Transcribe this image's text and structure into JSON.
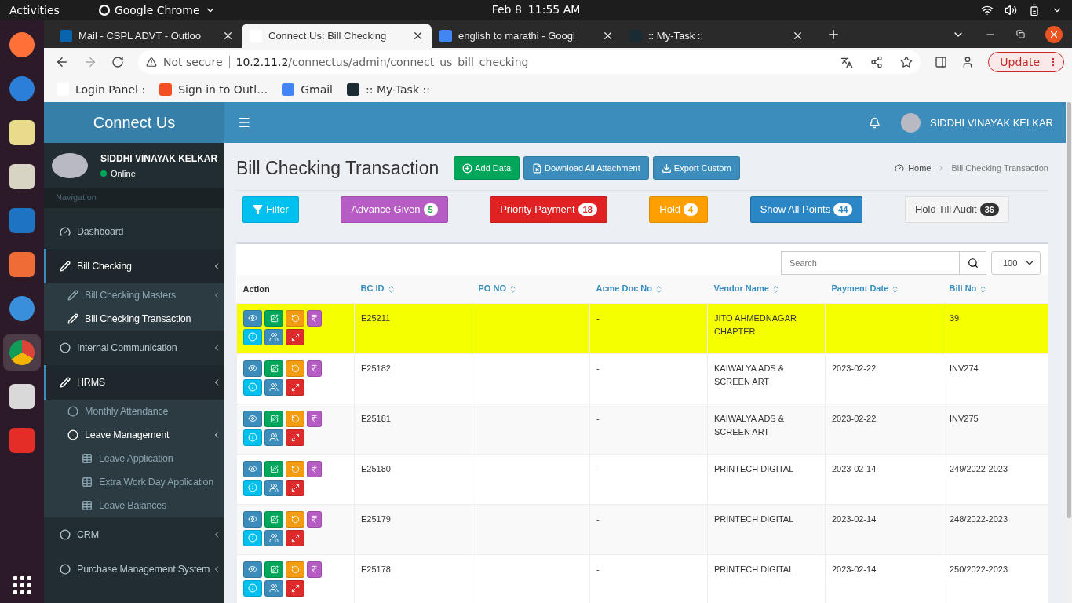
{
  "system_bar": {
    "activities": "Activities",
    "app_name": "Google Chrome",
    "date": "Feb 8",
    "time": "11:55 AM"
  },
  "browser": {
    "tabs": [
      {
        "title": "Mail - CSPL ADVT - Outloo",
        "selected": false,
        "kind": "outlook"
      },
      {
        "title": "Connect Us: Bill Checking",
        "selected": true,
        "kind": "site"
      },
      {
        "title": "english to marathi - Googl",
        "selected": false,
        "kind": "google"
      },
      {
        "title": ":: My-Task ::",
        "selected": false,
        "kind": "react"
      }
    ],
    "address": {
      "security": "Not secure",
      "host": "10.2.11.2",
      "path": "/connectus/admin/connect_us_bill_checking"
    },
    "update_button": "Update",
    "bookmarks": [
      {
        "label": "Login Panel :",
        "kind": "site"
      },
      {
        "label": "Sign in to Outl…",
        "kind": "windows"
      },
      {
        "label": "Gmail",
        "kind": "google"
      },
      {
        "label": ":: My-Task ::",
        "kind": "react"
      }
    ]
  },
  "app": {
    "brand": "Connect Us",
    "header_user": "SIDDHI VINAYAK KELKAR",
    "sidebar": {
      "user_name": "SIDDHI VINAYAK KELKAR",
      "status": "Online",
      "nav_header": "Navigation",
      "items": [
        {
          "label": "Dashboard",
          "kind": "gauge",
          "selected": false
        },
        {
          "label": "Bill Checking",
          "kind": "pencil",
          "selected": true,
          "has_submenu": true,
          "expanded": true,
          "children": [
            {
              "label": "Bill Checking Masters",
              "kind": "pencil",
              "selected": false,
              "has_submenu": true
            },
            {
              "label": "Bill Checking Transaction",
              "kind": "pencil",
              "selected": true
            }
          ]
        },
        {
          "label": "Internal Communication",
          "kind": "circle",
          "selected": false,
          "has_submenu": true
        },
        {
          "label": "HRMS",
          "kind": "pencil",
          "selected": true,
          "has_submenu": true,
          "expanded": true,
          "children": [
            {
              "label": "Monthly Attendance",
              "kind": "circle",
              "selected": false
            },
            {
              "label": "Leave Management",
              "kind": "circle",
              "selected": true,
              "has_submenu": true,
              "expanded": true,
              "children": [
                {
                  "label": "Leave Application",
                  "kind": "table",
                  "selected": false
                },
                {
                  "label": "Extra Work Day Application",
                  "kind": "table",
                  "selected": false
                },
                {
                  "label": "Leave Balances",
                  "kind": "table",
                  "selected": false
                }
              ]
            }
          ]
        },
        {
          "label": "CRM",
          "kind": "circle",
          "selected": false,
          "has_submenu": true
        },
        {
          "label": "Purchase Management System",
          "kind": "circle",
          "selected": false,
          "has_submenu": true
        }
      ]
    },
    "page_title": "Bill Checking Transaction",
    "actions": [
      {
        "label": "Add Data",
        "kind": "add"
      },
      {
        "label": "Download All Attachment",
        "kind": "download_all"
      },
      {
        "label": "Export Custom",
        "kind": "export"
      }
    ],
    "breadcrumb": [
      "Home",
      "Bill Checking Transaction"
    ],
    "filters": [
      {
        "label": "Filter",
        "kind": "filter"
      },
      {
        "label": "Advance Given",
        "count": "5",
        "kind": "purple"
      },
      {
        "label": "Priority Payment",
        "count": "18",
        "kind": "danger"
      },
      {
        "label": "Hold",
        "count": "4",
        "kind": "warning"
      },
      {
        "label": "Show All Points",
        "count": "44",
        "kind": "primary"
      },
      {
        "label": "Hold Till Audit",
        "count": "36",
        "kind": "default"
      }
    ],
    "search": {
      "placeholder": "Search"
    },
    "page_size": "100",
    "table": {
      "columns": [
        "Action",
        "BC ID",
        "PO NO",
        "Acme Doc No",
        "Vendor Name",
        "Payment Date",
        "Bill No"
      ],
      "rows": [
        {
          "bc_id": "E25211",
          "po_no": "",
          "acme_doc_no": "-",
          "vendor_name": "JITO AHMEDNAGAR CHAPTER",
          "payment_date": "",
          "bill_no": "39",
          "highlighted": true
        },
        {
          "bc_id": "E25182",
          "po_no": "",
          "acme_doc_no": "-",
          "vendor_name": "KAIWALYA ADS & SCREEN ART",
          "payment_date": "2023-02-22",
          "bill_no": "INV274",
          "highlighted": false
        },
        {
          "bc_id": "E25181",
          "po_no": "",
          "acme_doc_no": "-",
          "vendor_name": "KAIWALYA ADS & SCREEN ART",
          "payment_date": "2023-02-22",
          "bill_no": "INV275",
          "highlighted": false
        },
        {
          "bc_id": "E25180",
          "po_no": "",
          "acme_doc_no": "-",
          "vendor_name": "PRINTECH DIGITAL",
          "payment_date": "2023-02-14",
          "bill_no": "249/2022-2023",
          "highlighted": false
        },
        {
          "bc_id": "E25179",
          "po_no": "",
          "acme_doc_no": "-",
          "vendor_name": "PRINTECH DIGITAL",
          "payment_date": "2023-02-14",
          "bill_no": "248/2022-2023",
          "highlighted": false
        },
        {
          "bc_id": "E25178",
          "po_no": "",
          "acme_doc_no": "-",
          "vendor_name": "PRINTECH DIGITAL",
          "payment_date": "2023-02-14",
          "bill_no": "250/2022-2023",
          "highlighted": false
        }
      ]
    }
  }
}
